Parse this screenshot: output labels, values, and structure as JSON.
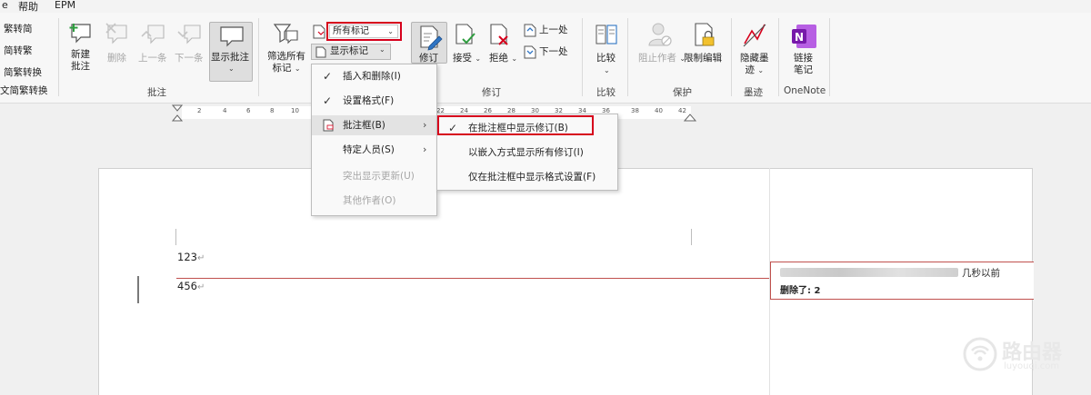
{
  "menubar": {
    "help": "帮助",
    "epm": "EPM"
  },
  "ribbon": {
    "chinese_convert": {
      "to_simplified": "繁转简",
      "to_traditional": "简转繁",
      "convert": "简繁转换",
      "label": "文简繁转换"
    },
    "comments": {
      "new": [
        "新建",
        "批注"
      ],
      "delete": "删除",
      "previous": "上一条",
      "next": "下一条",
      "show": "显示批注",
      "label": "批注"
    },
    "tracking": {
      "filter": [
        "筛选所有",
        "标记"
      ],
      "markup_dropdown": "所有标记",
      "show_markup": "显示标记",
      "track": "修订",
      "accept": "接受",
      "reject": "拒绝",
      "prev_change": "上一处",
      "next_change": "下一处",
      "label": "修订"
    },
    "compare": {
      "button": "比较",
      "label": "比较"
    },
    "protect": {
      "block_authors": "阻止作者",
      "restrict": "限制编辑",
      "label": "保护"
    },
    "ink": {
      "hide": [
        "隐藏墨",
        "迹"
      ],
      "label": "墨迹"
    },
    "onenote": {
      "link": [
        "链接",
        "笔记"
      ],
      "label": "OneNote"
    }
  },
  "ruler": {
    "left_ticks": [
      "2",
      "4",
      "6",
      "8",
      "10"
    ],
    "right_ticks": [
      "22",
      "24",
      "26",
      "28",
      "30",
      "32",
      "34",
      "36",
      "38",
      "40",
      "42"
    ]
  },
  "show_markup_menu": {
    "items": [
      {
        "label": "插入和删除(I)",
        "checked": true
      },
      {
        "label": "设置格式(F)",
        "checked": true
      },
      {
        "label": "批注框(B)"
      },
      {
        "label": "特定人员(S)"
      },
      {
        "label": "突出显示更新(U)",
        "disabled": true
      },
      {
        "label": "其他作者(O)",
        "disabled": true
      }
    ]
  },
  "balloons_submenu": {
    "items": [
      {
        "label": "在批注框中显示修订(B)",
        "checked": true
      },
      {
        "label": "以嵌入方式显示所有修订(I)"
      },
      {
        "label": "仅在批注框中显示格式设置(F)"
      }
    ]
  },
  "document": {
    "lines": [
      "123",
      "456"
    ],
    "para_mark": "↵",
    "balloon": {
      "time": "几秒以前",
      "change": "删除了: 2"
    }
  },
  "watermark": {
    "name": "路由器",
    "url": "luyouqi.com"
  },
  "colors": {
    "highlight_red": "#d6001c",
    "balloon_red": "#c0504d",
    "onenote_purple": "#7719aa"
  }
}
